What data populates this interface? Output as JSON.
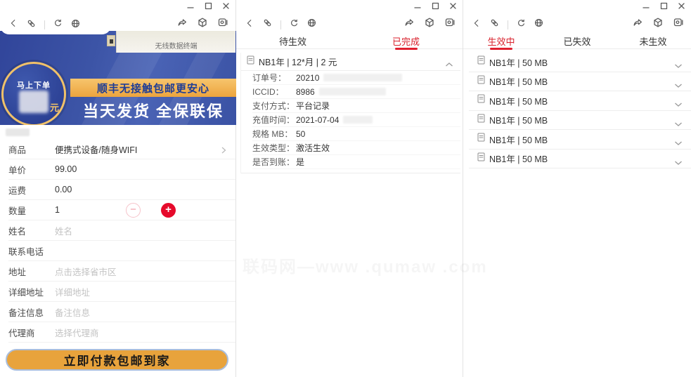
{
  "colors": {
    "accent_red": "#e01f2f",
    "banner_blue": "#3c54a6",
    "gold": "#e8a33c",
    "ribbon_gold": "#eca43e"
  },
  "watermark": "联码网—www .qumaw .com",
  "left_window": {
    "photo_caption": "无线数据终端",
    "banner": {
      "badge_line1": "马上下单",
      "badge_unit": "元",
      "ribbon_text": "顺丰无接触包邮更安心",
      "headline": "当天发货 全保联保"
    },
    "form": {
      "rows": [
        {
          "label": "商品",
          "value": "便携式设备/随身WIFI"
        },
        {
          "label": "单价",
          "value": "99.00"
        },
        {
          "label": "运费",
          "value": "0.00"
        },
        {
          "label": "数量",
          "value": "1"
        },
        {
          "label": "姓名",
          "placeholder": "姓名"
        },
        {
          "label": "联系电话",
          "placeholder": ""
        },
        {
          "label": "地址",
          "placeholder": "点击选择省市区"
        },
        {
          "label": "详细地址",
          "placeholder": "详细地址"
        },
        {
          "label": "备注信息",
          "placeholder": "备注信息"
        },
        {
          "label": "代理商",
          "placeholder": "选择代理商"
        }
      ],
      "stepper": {
        "minus": "−",
        "plus": "+"
      }
    },
    "submit_label": "立即付款包邮到家"
  },
  "middle_window": {
    "tabs": [
      {
        "label": "待生效"
      },
      {
        "label": "已完成"
      }
    ],
    "card": {
      "title": "NB1年 | 12*月 | 2 元",
      "details": [
        {
          "label": "订单号：",
          "value": "20210"
        },
        {
          "label": "ICCID：",
          "value": "8986"
        },
        {
          "label": "支付方式：",
          "value": "平台记录"
        },
        {
          "label": "充值时间：",
          "value": "2021-07-04"
        },
        {
          "label": "规格 MB：",
          "value": "50"
        },
        {
          "label": "生效类型：",
          "value": "激活生效"
        },
        {
          "label": "是否到账：",
          "value": "是"
        }
      ]
    }
  },
  "right_window": {
    "tabs": [
      {
        "label": "生效中"
      },
      {
        "label": "已失效"
      },
      {
        "label": "未生效"
      }
    ],
    "items": [
      {
        "title": "NB1年 | 50 MB"
      },
      {
        "title": "NB1年 | 50 MB"
      },
      {
        "title": "NB1年 | 50 MB"
      },
      {
        "title": "NB1年 | 50 MB"
      },
      {
        "title": "NB1年 | 50 MB"
      },
      {
        "title": "NB1年 | 50 MB"
      }
    ]
  }
}
